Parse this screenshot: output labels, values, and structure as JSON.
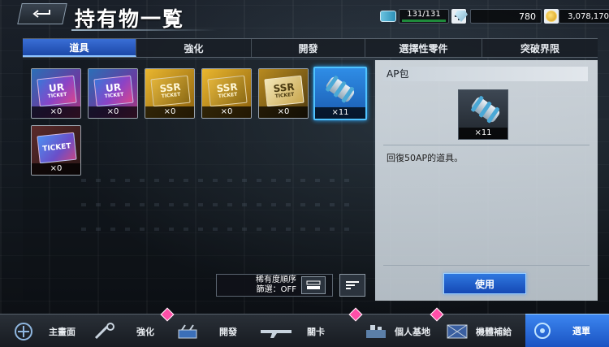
{
  "header": {
    "title": "持有物一覧",
    "back_icon": "back-arrow-icon",
    "ap": "131/131",
    "gems": "780",
    "coins": "3,078,170"
  },
  "tabs": [
    {
      "label": "道具",
      "active": true
    },
    {
      "label": "強化",
      "active": false
    },
    {
      "label": "開發",
      "active": false
    },
    {
      "label": "選擇性零件",
      "active": false
    },
    {
      "label": "突破界限",
      "active": false
    }
  ],
  "items": [
    {
      "type": "UR TICKET",
      "count": "×0"
    },
    {
      "type": "UR TICKET",
      "count": "×0"
    },
    {
      "type": "SSR TICKET",
      "count": "×0"
    },
    {
      "type": "SSR TICKET",
      "count": "×0"
    },
    {
      "type": "SSR TICKET",
      "count": "×0"
    },
    {
      "type": "AP包",
      "count": "×11"
    },
    {
      "type": "TICKET",
      "count": "×0"
    }
  ],
  "sort": {
    "line1": "稀有度順序",
    "line2": "篩選：OFF"
  },
  "detail": {
    "name": "AP包",
    "count": "×11",
    "description": "回復50AP的道具。",
    "use_label": "使用"
  },
  "nav": [
    {
      "label": "主畫面",
      "icon": "home-icon"
    },
    {
      "label": "強化",
      "icon": "wrench-icon"
    },
    {
      "label": "開發",
      "icon": "development-icon"
    },
    {
      "label": "關卡",
      "icon": "rifle-icon"
    },
    {
      "label": "個人基地",
      "icon": "base-icon"
    },
    {
      "label": "機體補給",
      "icon": "supply-icon"
    },
    {
      "label": "選單",
      "icon": "menu-icon"
    }
  ],
  "colors": {
    "accent": "#1c48a8",
    "badge": "#ff4fa8",
    "selected": "#4fc3ff"
  }
}
